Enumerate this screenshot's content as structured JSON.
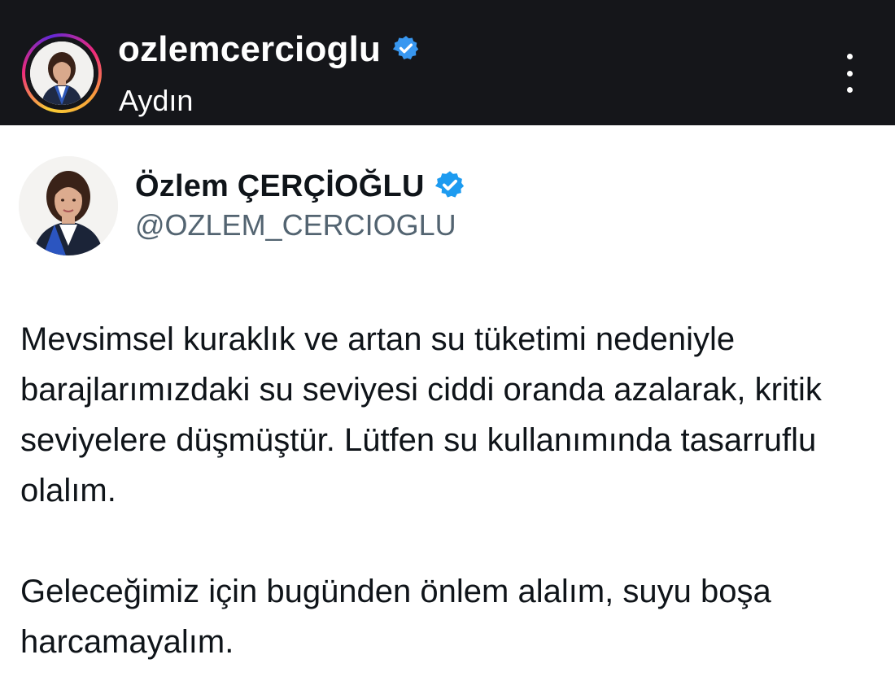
{
  "instagram": {
    "username": "ozlemcercioglu",
    "location": "Aydın",
    "icons": {
      "verified": "verified-badge-icon",
      "more": "more-options-icon"
    }
  },
  "tweet": {
    "display_name": "Özlem ÇERÇİOĞLU",
    "handle": "@OZLEM_CERCIOGLU",
    "paragraphs": [
      "Mevsimsel kuraklık ve artan su tüketimi nedeniyle barajlarımızdaki su seviyesi ciddi oranda azalarak, kritik seviyelere düşmüştür. Lütfen su kullanımında tasarruflu olalım.",
      "Geleceğimiz için bugünden önlem alalım, suyu boşa harcamayalım."
    ]
  },
  "colors": {
    "header_bg": "#15161a",
    "verified_blue": "#1d9bf0",
    "text_primary": "#0f1419",
    "text_secondary": "#536471"
  }
}
